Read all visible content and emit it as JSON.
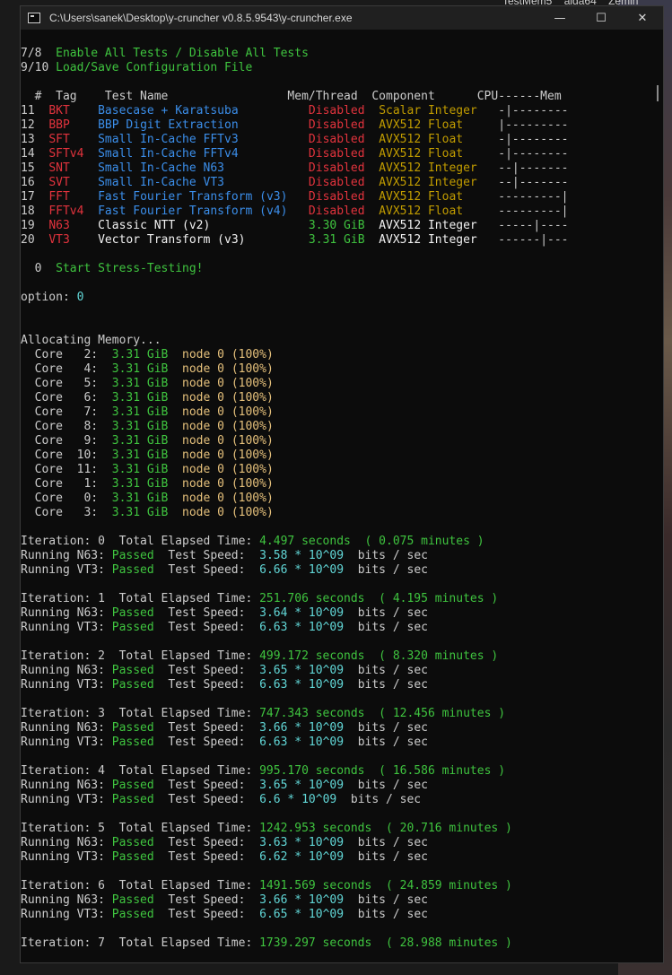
{
  "desktop": {
    "icons": [
      "TestMem5",
      "aida64",
      "Zemin"
    ]
  },
  "window": {
    "title": "C:\\Users\\sanek\\Desktop\\y-cruncher v0.8.5.9543\\y-cruncher.exe",
    "minimize": "—",
    "maximize": "☐",
    "close": "✕"
  },
  "colors": {
    "green": "#3fc43f",
    "red": "#e2333d",
    "blue": "#3b8eea",
    "yellow": "#e5c07b",
    "cyan": "#61d6d6",
    "gold": "#c19c00",
    "text": "#cccccc"
  },
  "lines": [
    [
      [
        "w",
        "7/8  "
      ],
      [
        "g",
        "Enable All Tests / Disable All Tests"
      ]
    ],
    [
      [
        "w",
        "9/10 "
      ],
      [
        "g",
        "Load/Save Configuration File"
      ]
    ],
    [],
    [
      [
        "w",
        "  #  Tag    Test Name                 Mem/Thread  Component      CPU------Mem"
      ]
    ],
    [
      [
        "w",
        "11  "
      ],
      [
        "r",
        "BKT    "
      ],
      [
        "b",
        "Basecase + Karatsuba       "
      ],
      [
        "r",
        "   Disabled  "
      ],
      [
        "o",
        "Scalar Integer "
      ],
      [
        "w",
        "  -|--------"
      ]
    ],
    [
      [
        "w",
        "12  "
      ],
      [
        "r",
        "BBP    "
      ],
      [
        "b",
        "BBP Digit Extraction       "
      ],
      [
        "r",
        "   Disabled  "
      ],
      [
        "o",
        "AVX512 Float   "
      ],
      [
        "w",
        "  |---------"
      ]
    ],
    [
      [
        "w",
        "13  "
      ],
      [
        "r",
        "SFT    "
      ],
      [
        "b",
        "Small In-Cache FFTv3       "
      ],
      [
        "r",
        "   Disabled  "
      ],
      [
        "o",
        "AVX512 Float   "
      ],
      [
        "w",
        "  -|--------"
      ]
    ],
    [
      [
        "w",
        "14  "
      ],
      [
        "r",
        "SFTv4  "
      ],
      [
        "b",
        "Small In-Cache FFTv4       "
      ],
      [
        "r",
        "   Disabled  "
      ],
      [
        "o",
        "AVX512 Float   "
      ],
      [
        "w",
        "  -|--------"
      ]
    ],
    [
      [
        "w",
        "15  "
      ],
      [
        "r",
        "SNT    "
      ],
      [
        "b",
        "Small In-Cache N63         "
      ],
      [
        "r",
        "   Disabled  "
      ],
      [
        "o",
        "AVX512 Integer "
      ],
      [
        "w",
        "  --|-------"
      ]
    ],
    [
      [
        "w",
        "16  "
      ],
      [
        "r",
        "SVT    "
      ],
      [
        "b",
        "Small In-Cache VT3         "
      ],
      [
        "r",
        "   Disabled  "
      ],
      [
        "o",
        "AVX512 Integer "
      ],
      [
        "w",
        "  --|-------"
      ]
    ],
    [
      [
        "w",
        "17  "
      ],
      [
        "r",
        "FFT    "
      ],
      [
        "b",
        "Fast Fourier Transform (v3)"
      ],
      [
        "r",
        "   Disabled  "
      ],
      [
        "o",
        "AVX512 Float   "
      ],
      [
        "w",
        "  ---------|"
      ]
    ],
    [
      [
        "w",
        "18  "
      ],
      [
        "r",
        "FFTv4  "
      ],
      [
        "b",
        "Fast Fourier Transform (v4)"
      ],
      [
        "r",
        "   Disabled  "
      ],
      [
        "o",
        "AVX512 Float   "
      ],
      [
        "w",
        "  ---------|"
      ]
    ],
    [
      [
        "w",
        "19  "
      ],
      [
        "r",
        "N63    "
      ],
      [
        "bw",
        "Classic NTT (v2)           "
      ],
      [
        "g",
        "   3.30 GiB  "
      ],
      [
        "bw",
        "AVX512 Integer "
      ],
      [
        "w",
        "  -----|----"
      ]
    ],
    [
      [
        "w",
        "20  "
      ],
      [
        "r",
        "VT3    "
      ],
      [
        "bw",
        "Vector Transform (v3)      "
      ],
      [
        "g",
        "   3.31 GiB  "
      ],
      [
        "bw",
        "AVX512 Integer "
      ],
      [
        "w",
        "  ------|---"
      ]
    ],
    [],
    [
      [
        "w",
        "  0  "
      ],
      [
        "g",
        "Start Stress-Testing!"
      ]
    ],
    [],
    [
      [
        "w",
        "option: "
      ],
      [
        "c",
        "0"
      ]
    ],
    [],
    [],
    [
      [
        "w",
        "Allocating Memory..."
      ]
    ],
    [
      [
        "w",
        "  Core   2:  "
      ],
      [
        "g",
        "3.31 GiB"
      ],
      [
        "w",
        "  "
      ],
      [
        "y",
        "node 0 (100%)"
      ]
    ],
    [
      [
        "w",
        "  Core   4:  "
      ],
      [
        "g",
        "3.31 GiB"
      ],
      [
        "w",
        "  "
      ],
      [
        "y",
        "node 0 (100%)"
      ]
    ],
    [
      [
        "w",
        "  Core   5:  "
      ],
      [
        "g",
        "3.31 GiB"
      ],
      [
        "w",
        "  "
      ],
      [
        "y",
        "node 0 (100%)"
      ]
    ],
    [
      [
        "w",
        "  Core   6:  "
      ],
      [
        "g",
        "3.31 GiB"
      ],
      [
        "w",
        "  "
      ],
      [
        "y",
        "node 0 (100%)"
      ]
    ],
    [
      [
        "w",
        "  Core   7:  "
      ],
      [
        "g",
        "3.31 GiB"
      ],
      [
        "w",
        "  "
      ],
      [
        "y",
        "node 0 (100%)"
      ]
    ],
    [
      [
        "w",
        "  Core   8:  "
      ],
      [
        "g",
        "3.31 GiB"
      ],
      [
        "w",
        "  "
      ],
      [
        "y",
        "node 0 (100%)"
      ]
    ],
    [
      [
        "w",
        "  Core   9:  "
      ],
      [
        "g",
        "3.31 GiB"
      ],
      [
        "w",
        "  "
      ],
      [
        "y",
        "node 0 (100%)"
      ]
    ],
    [
      [
        "w",
        "  Core  10:  "
      ],
      [
        "g",
        "3.31 GiB"
      ],
      [
        "w",
        "  "
      ],
      [
        "y",
        "node 0 (100%)"
      ]
    ],
    [
      [
        "w",
        "  Core  11:  "
      ],
      [
        "g",
        "3.31 GiB"
      ],
      [
        "w",
        "  "
      ],
      [
        "y",
        "node 0 (100%)"
      ]
    ],
    [
      [
        "w",
        "  Core   1:  "
      ],
      [
        "g",
        "3.31 GiB"
      ],
      [
        "w",
        "  "
      ],
      [
        "y",
        "node 0 (100%)"
      ]
    ],
    [
      [
        "w",
        "  Core   0:  "
      ],
      [
        "g",
        "3.31 GiB"
      ],
      [
        "w",
        "  "
      ],
      [
        "y",
        "node 0 (100%)"
      ]
    ],
    [
      [
        "w",
        "  Core   3:  "
      ],
      [
        "g",
        "3.31 GiB"
      ],
      [
        "w",
        "  "
      ],
      [
        "y",
        "node 0 (100%)"
      ]
    ],
    [],
    [
      [
        "w",
        "Iteration: 0  Total Elapsed Time: "
      ],
      [
        "g",
        "4.497 seconds  ( 0.075 minutes )"
      ]
    ],
    [
      [
        "w",
        "Running N63: "
      ],
      [
        "g",
        "Passed"
      ],
      [
        "w",
        "  Test Speed:  "
      ],
      [
        "c",
        "3.58 * 10^09"
      ],
      [
        "w",
        "  bits / sec"
      ]
    ],
    [
      [
        "w",
        "Running VT3: "
      ],
      [
        "g",
        "Passed"
      ],
      [
        "w",
        "  Test Speed:  "
      ],
      [
        "c",
        "6.66 * 10^09"
      ],
      [
        "w",
        "  bits / sec"
      ]
    ],
    [],
    [
      [
        "w",
        "Iteration: 1  Total Elapsed Time: "
      ],
      [
        "g",
        "251.706 seconds  ( 4.195 minutes )"
      ]
    ],
    [
      [
        "w",
        "Running N63: "
      ],
      [
        "g",
        "Passed"
      ],
      [
        "w",
        "  Test Speed:  "
      ],
      [
        "c",
        "3.64 * 10^09"
      ],
      [
        "w",
        "  bits / sec"
      ]
    ],
    [
      [
        "w",
        "Running VT3: "
      ],
      [
        "g",
        "Passed"
      ],
      [
        "w",
        "  Test Speed:  "
      ],
      [
        "c",
        "6.63 * 10^09"
      ],
      [
        "w",
        "  bits / sec"
      ]
    ],
    [],
    [
      [
        "w",
        "Iteration: 2  Total Elapsed Time: "
      ],
      [
        "g",
        "499.172 seconds  ( 8.320 minutes )"
      ]
    ],
    [
      [
        "w",
        "Running N63: "
      ],
      [
        "g",
        "Passed"
      ],
      [
        "w",
        "  Test Speed:  "
      ],
      [
        "c",
        "3.65 * 10^09"
      ],
      [
        "w",
        "  bits / sec"
      ]
    ],
    [
      [
        "w",
        "Running VT3: "
      ],
      [
        "g",
        "Passed"
      ],
      [
        "w",
        "  Test Speed:  "
      ],
      [
        "c",
        "6.63 * 10^09"
      ],
      [
        "w",
        "  bits / sec"
      ]
    ],
    [],
    [
      [
        "w",
        "Iteration: 3  Total Elapsed Time: "
      ],
      [
        "g",
        "747.343 seconds  ( 12.456 minutes )"
      ]
    ],
    [
      [
        "w",
        "Running N63: "
      ],
      [
        "g",
        "Passed"
      ],
      [
        "w",
        "  Test Speed:  "
      ],
      [
        "c",
        "3.66 * 10^09"
      ],
      [
        "w",
        "  bits / sec"
      ]
    ],
    [
      [
        "w",
        "Running VT3: "
      ],
      [
        "g",
        "Passed"
      ],
      [
        "w",
        "  Test Speed:  "
      ],
      [
        "c",
        "6.63 * 10^09"
      ],
      [
        "w",
        "  bits / sec"
      ]
    ],
    [],
    [
      [
        "w",
        "Iteration: 4  Total Elapsed Time: "
      ],
      [
        "g",
        "995.170 seconds  ( 16.586 minutes )"
      ]
    ],
    [
      [
        "w",
        "Running N63: "
      ],
      [
        "g",
        "Passed"
      ],
      [
        "w",
        "  Test Speed:  "
      ],
      [
        "c",
        "3.65 * 10^09"
      ],
      [
        "w",
        "  bits / sec"
      ]
    ],
    [
      [
        "w",
        "Running VT3: "
      ],
      [
        "g",
        "Passed"
      ],
      [
        "w",
        "  Test Speed:  "
      ],
      [
        "c",
        "6.6 * 10^09"
      ],
      [
        "w",
        "  bits / sec"
      ]
    ],
    [],
    [
      [
        "w",
        "Iteration: 5  Total Elapsed Time: "
      ],
      [
        "g",
        "1242.953 seconds  ( 20.716 minutes )"
      ]
    ],
    [
      [
        "w",
        "Running N63: "
      ],
      [
        "g",
        "Passed"
      ],
      [
        "w",
        "  Test Speed:  "
      ],
      [
        "c",
        "3.63 * 10^09"
      ],
      [
        "w",
        "  bits / sec"
      ]
    ],
    [
      [
        "w",
        "Running VT3: "
      ],
      [
        "g",
        "Passed"
      ],
      [
        "w",
        "  Test Speed:  "
      ],
      [
        "c",
        "6.62 * 10^09"
      ],
      [
        "w",
        "  bits / sec"
      ]
    ],
    [],
    [
      [
        "w",
        "Iteration: 6  Total Elapsed Time: "
      ],
      [
        "g",
        "1491.569 seconds  ( 24.859 minutes )"
      ]
    ],
    [
      [
        "w",
        "Running N63: "
      ],
      [
        "g",
        "Passed"
      ],
      [
        "w",
        "  Test Speed:  "
      ],
      [
        "c",
        "3.66 * 10^09"
      ],
      [
        "w",
        "  bits / sec"
      ]
    ],
    [
      [
        "w",
        "Running VT3: "
      ],
      [
        "g",
        "Passed"
      ],
      [
        "w",
        "  Test Speed:  "
      ],
      [
        "c",
        "6.65 * 10^09"
      ],
      [
        "w",
        "  bits / sec"
      ]
    ],
    [],
    [
      [
        "w",
        "Iteration: 7  Total Elapsed Time: "
      ],
      [
        "g",
        "1739.297 seconds  ( 28.988 minutes )"
      ]
    ]
  ]
}
